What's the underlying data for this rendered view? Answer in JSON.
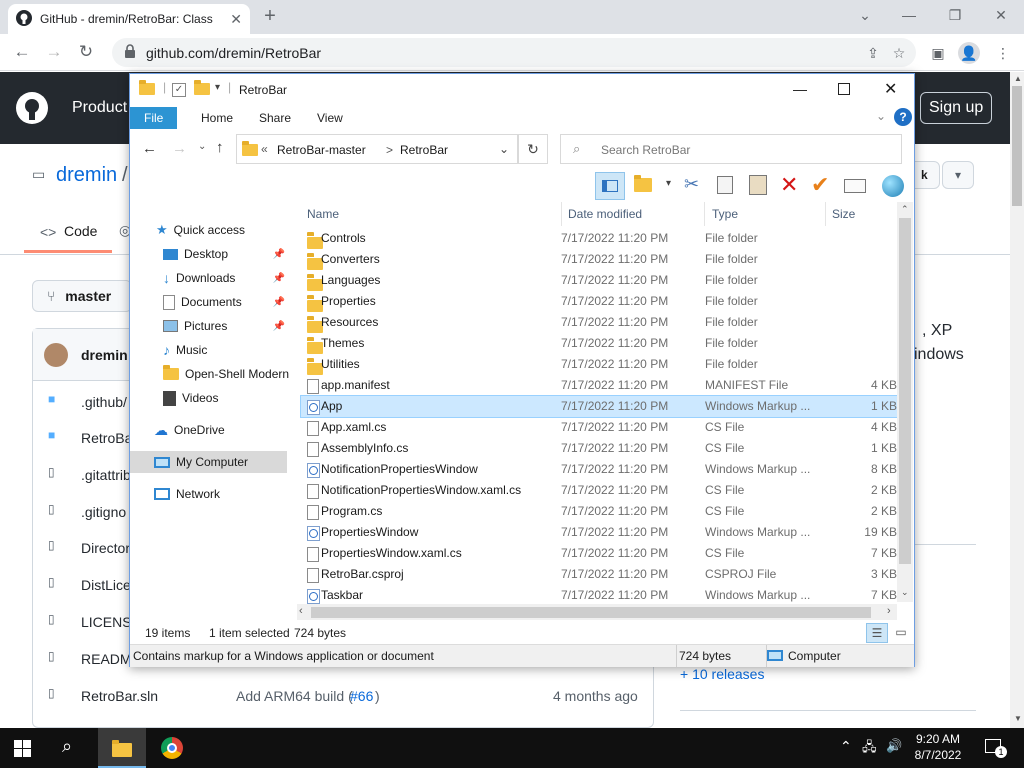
{
  "browser": {
    "tab_title": "GitHub - dremin/RetroBar: Class",
    "url": "github.com/dremin/RetroBar"
  },
  "github": {
    "product_label": "Product",
    "signup_label": "Sign up",
    "owner": "dremin",
    "slash": "/",
    "code_tab": "Code",
    "branch": "master",
    "author": "dremin",
    "files": [
      ".github/",
      "RetroBar",
      ".gitattrib",
      ".gitigno",
      "Director",
      "DistLice",
      "LICENSE",
      "READM",
      "RetroBar.sln"
    ],
    "last_commit_message": "Add ARM64 build (",
    "last_commit_link": "#66",
    "last_commit_close": ")",
    "last_commit_time": "4 months ago",
    "about_frag1": ", XP",
    "about_frag2": "indows",
    "releases": "+ 10 releases",
    "notify_frag": "k"
  },
  "explorer": {
    "title": "RetroBar",
    "ribbon": {
      "file": "File",
      "home": "Home",
      "share": "Share",
      "view": "View"
    },
    "breadcrumb": {
      "chev": "«",
      "part1": "RetroBar-master",
      "sep": ">",
      "part2": "RetroBar"
    },
    "search_placeholder": "Search RetroBar",
    "columns": {
      "name": "Name",
      "date": "Date modified",
      "type": "Type",
      "size": "Size"
    },
    "nav": {
      "quick_access": "Quick access",
      "desktop": "Desktop",
      "downloads": "Downloads",
      "documents": "Documents",
      "pictures": "Pictures",
      "music": "Music",
      "openshell": "Open-Shell Modern",
      "videos": "Videos",
      "onedrive": "OneDrive",
      "mycomputer": "My Computer",
      "network": "Network"
    },
    "rows": [
      {
        "name": "Controls",
        "date": "7/17/2022 11:20 PM",
        "type": "File folder",
        "size": "",
        "icon": "folder-icon"
      },
      {
        "name": "Converters",
        "date": "7/17/2022 11:20 PM",
        "type": "File folder",
        "size": "",
        "icon": "folder-icon"
      },
      {
        "name": "Languages",
        "date": "7/17/2022 11:20 PM",
        "type": "File folder",
        "size": "",
        "icon": "folder-icon"
      },
      {
        "name": "Properties",
        "date": "7/17/2022 11:20 PM",
        "type": "File folder",
        "size": "",
        "icon": "folder-icon"
      },
      {
        "name": "Resources",
        "date": "7/17/2022 11:20 PM",
        "type": "File folder",
        "size": "",
        "icon": "folder-icon"
      },
      {
        "name": "Themes",
        "date": "7/17/2022 11:20 PM",
        "type": "File folder",
        "size": "",
        "icon": "folder-icon"
      },
      {
        "name": "Utilities",
        "date": "7/17/2022 11:20 PM",
        "type": "File folder",
        "size": "",
        "icon": "folder-icon"
      },
      {
        "name": "app.manifest",
        "date": "7/17/2022 11:20 PM",
        "type": "MANIFEST File",
        "size": "4 KB",
        "icon": "file-icon"
      },
      {
        "name": "App",
        "date": "7/17/2022 11:20 PM",
        "type": "Windows Markup ...",
        "size": "1 KB",
        "icon": "xaml-icon",
        "selected": true
      },
      {
        "name": "App.xaml.cs",
        "date": "7/17/2022 11:20 PM",
        "type": "CS File",
        "size": "4 KB",
        "icon": "file-icon"
      },
      {
        "name": "AssemblyInfo.cs",
        "date": "7/17/2022 11:20 PM",
        "type": "CS File",
        "size": "1 KB",
        "icon": "file-icon"
      },
      {
        "name": "NotificationPropertiesWindow",
        "date": "7/17/2022 11:20 PM",
        "type": "Windows Markup ...",
        "size": "8 KB",
        "icon": "xaml-icon"
      },
      {
        "name": "NotificationPropertiesWindow.xaml.cs",
        "date": "7/17/2022 11:20 PM",
        "type": "CS File",
        "size": "2 KB",
        "icon": "file-icon"
      },
      {
        "name": "Program.cs",
        "date": "7/17/2022 11:20 PM",
        "type": "CS File",
        "size": "2 KB",
        "icon": "file-icon"
      },
      {
        "name": "PropertiesWindow",
        "date": "7/17/2022 11:20 PM",
        "type": "Windows Markup ...",
        "size": "19 KB",
        "icon": "xaml-icon"
      },
      {
        "name": "PropertiesWindow.xaml.cs",
        "date": "7/17/2022 11:20 PM",
        "type": "CS File",
        "size": "7 KB",
        "icon": "file-icon"
      },
      {
        "name": "RetroBar.csproj",
        "date": "7/17/2022 11:20 PM",
        "type": "CSPROJ File",
        "size": "3 KB",
        "icon": "file-icon"
      },
      {
        "name": "Taskbar",
        "date": "7/17/2022 11:20 PM",
        "type": "Windows Markup ...",
        "size": "7 KB",
        "icon": "xaml-icon"
      }
    ],
    "status": {
      "items": "19 items",
      "selected": "1 item selected",
      "size": "724 bytes"
    },
    "detail_status": {
      "text": "Contains markup for a Windows application or document",
      "size": "724 bytes",
      "location": "Computer"
    }
  },
  "taskbar": {
    "time": "9:20 AM",
    "date": "8/7/2022",
    "notif_count": "1"
  },
  "colors": {
    "accent": "#2c94d3",
    "selected_row": "#cce8ff",
    "github_dark": "#24292f",
    "link": "#0969da"
  }
}
